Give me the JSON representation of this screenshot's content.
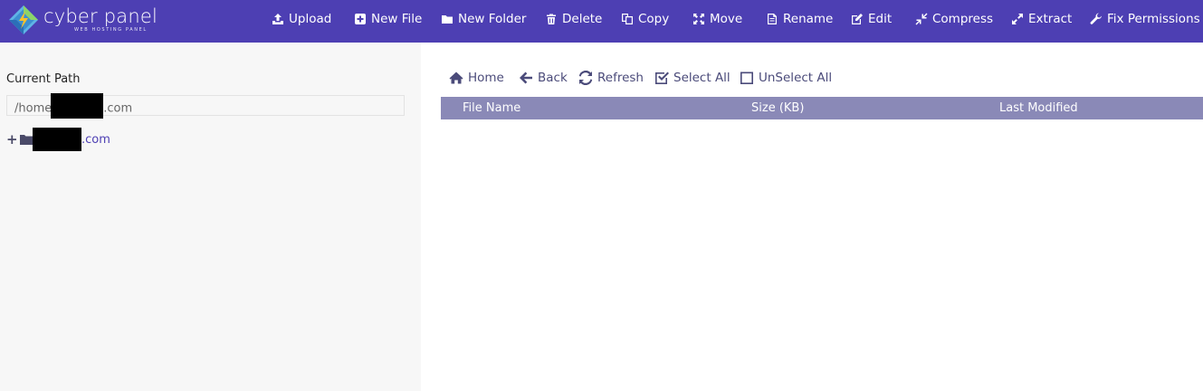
{
  "brand": {
    "title": "cyber panel",
    "subtitle": "WEB HOSTING PANEL"
  },
  "toolbar": [
    {
      "label": "Upload",
      "icon": "upload-icon"
    },
    {
      "label": "New File",
      "icon": "plus-square-icon"
    },
    {
      "label": "New Folder",
      "icon": "folder-icon"
    },
    {
      "label": "Delete",
      "icon": "trash-icon"
    },
    {
      "label": "Copy",
      "icon": "copy-icon"
    },
    {
      "label": "Move",
      "icon": "arrows-icon"
    },
    {
      "label": "Rename",
      "icon": "file-icon"
    },
    {
      "label": "Edit",
      "icon": "edit-icon"
    },
    {
      "label": "Compress",
      "icon": "compress-icon"
    },
    {
      "label": "Extract",
      "icon": "expand-icon"
    },
    {
      "label": "Fix Permissions",
      "icon": "wrench-icon"
    }
  ],
  "sidebar": {
    "current_path_label": "Current Path",
    "path_prefix": "/home",
    "path_suffix": ".com",
    "tree_item_suffix": ".com"
  },
  "nav": [
    {
      "label": "Home",
      "icon": "home-icon"
    },
    {
      "label": "Back",
      "icon": "arrow-left-icon"
    },
    {
      "label": "Refresh",
      "icon": "refresh-icon"
    },
    {
      "label": "Select All",
      "icon": "checkbox-checked-icon"
    },
    {
      "label": "UnSelect All",
      "icon": "checkbox-empty-icon"
    }
  ],
  "table": {
    "columns": [
      "File Name",
      "Size (KB)",
      "Last Modified"
    ]
  },
  "colors": {
    "header_bg": "#4d3fb3",
    "table_head_bg": "#8a89b7",
    "nav_text": "#4b4b7a"
  }
}
